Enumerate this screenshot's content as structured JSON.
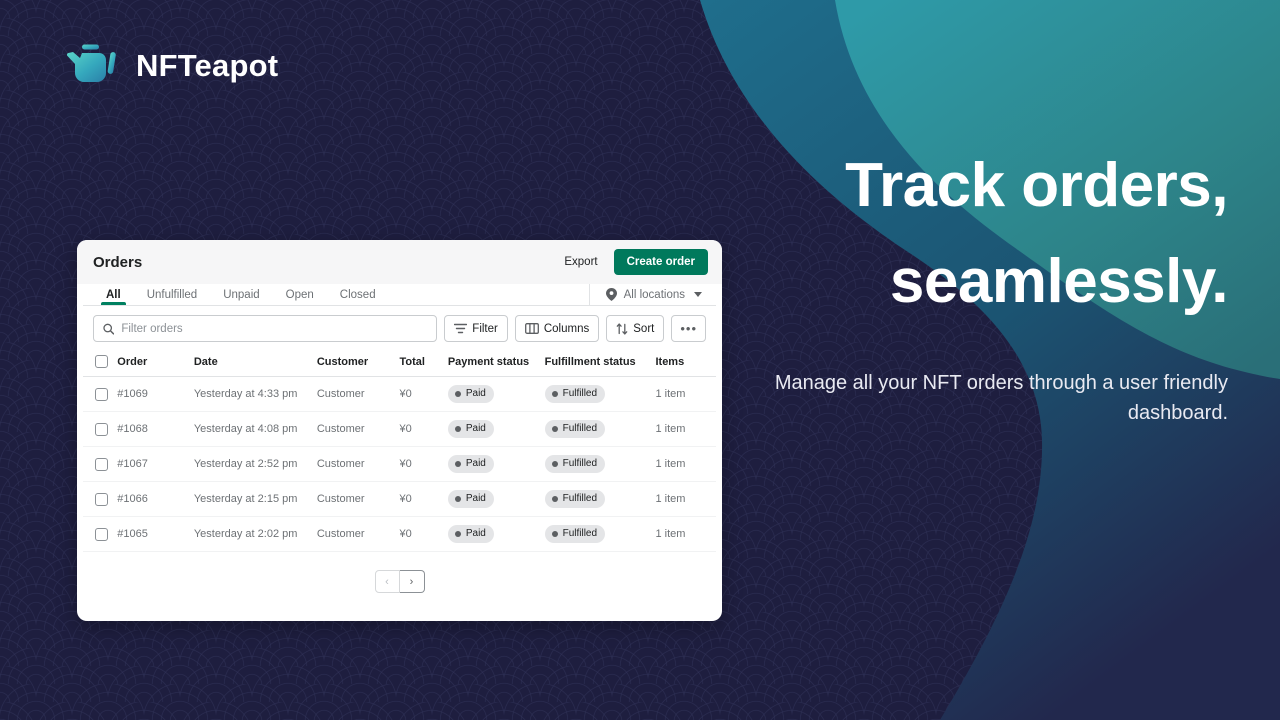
{
  "brand": {
    "name": "NFTeapot",
    "logo_icon": "teapot-icon",
    "logo_gradient_from": "#4fd1c5",
    "logo_gradient_to": "#2a7fa8"
  },
  "marketing": {
    "headline_line1": "Track orders,",
    "headline_line2": "seamlessly.",
    "subcopy": "Manage all your NFT orders through a user friendly dashboard."
  },
  "theme": {
    "background": "#1e1e3f",
    "pattern_stroke": "#2e3055",
    "wave_dark": "#1b4a63",
    "wave_light": "#2d8c8c",
    "accent_green": "#00795c"
  },
  "card": {
    "title": "Orders",
    "export_label": "Export",
    "create_label": "Create order",
    "tabs": [
      {
        "label": "All",
        "active": true
      },
      {
        "label": "Unfulfilled",
        "active": false
      },
      {
        "label": "Unpaid",
        "active": false
      },
      {
        "label": "Open",
        "active": false
      },
      {
        "label": "Closed",
        "active": false
      }
    ],
    "locations": {
      "label": "All locations",
      "icon": "location-pin-icon",
      "caret": "chevron-down-icon"
    },
    "toolbar": {
      "search_placeholder": "Filter orders",
      "search_value": "",
      "search_icon": "search-icon",
      "filter_label": "Filter",
      "filter_icon": "filter-icon",
      "columns_label": "Columns",
      "columns_icon": "columns-icon",
      "sort_label": "Sort",
      "sort_icon": "sort-arrows-icon",
      "more_label": "•••"
    },
    "table": {
      "columns": [
        "Order",
        "Date",
        "Customer",
        "Total",
        "Payment status",
        "Fulfillment status",
        "Items"
      ],
      "rows": [
        {
          "order": "#1069",
          "date": "Yesterday at 4:33 pm",
          "customer": "Customer",
          "total": "¥0",
          "payment_status": "Paid",
          "fulfillment_status": "Fulfilled",
          "items": "1 item"
        },
        {
          "order": "#1068",
          "date": "Yesterday at 4:08 pm",
          "customer": "Customer",
          "total": "¥0",
          "payment_status": "Paid",
          "fulfillment_status": "Fulfilled",
          "items": "1 item"
        },
        {
          "order": "#1067",
          "date": "Yesterday at 2:52 pm",
          "customer": "Customer",
          "total": "¥0",
          "payment_status": "Paid",
          "fulfillment_status": "Fulfilled",
          "items": "1 item"
        },
        {
          "order": "#1066",
          "date": "Yesterday at 2:15 pm",
          "customer": "Customer",
          "total": "¥0",
          "payment_status": "Paid",
          "fulfillment_status": "Fulfilled",
          "items": "1 item"
        },
        {
          "order": "#1065",
          "date": "Yesterday at 2:02 pm",
          "customer": "Customer",
          "total": "¥0",
          "payment_status": "Paid",
          "fulfillment_status": "Fulfilled",
          "items": "1 item"
        }
      ]
    },
    "pagination": {
      "prev_label": "‹",
      "next_label": "›"
    }
  }
}
